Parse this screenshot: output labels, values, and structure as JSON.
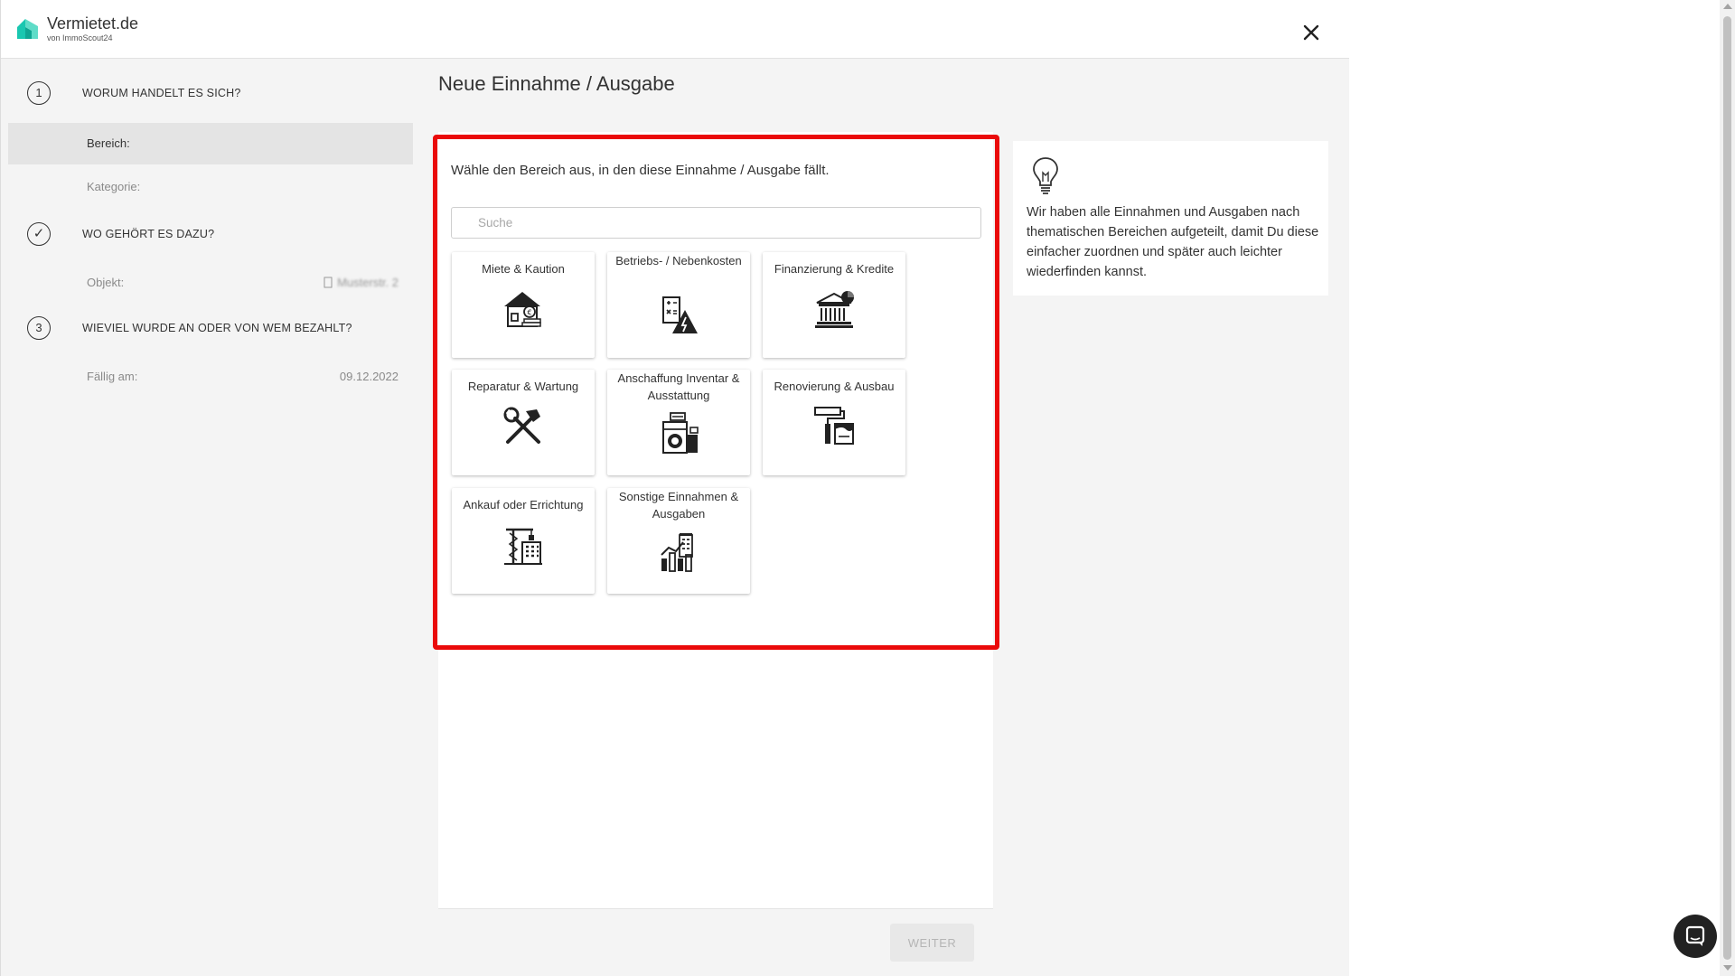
{
  "brand": {
    "name": "Vermietet.de",
    "sub": "von ImmoScout24",
    "color": "#19c7b0"
  },
  "icons": {
    "close": "close-icon",
    "logo": "house-logo-icon",
    "tip": "lightbulb-icon",
    "chat": "chat-icon",
    "object": "building-icon"
  },
  "sidebar": {
    "steps": [
      {
        "marker": "1",
        "title": "WORUM HANDELT ES SICH?"
      },
      {
        "marker": "✓",
        "title": "WO GEHÖRT ES DAZU?"
      },
      {
        "marker": "3",
        "title": "WIEVIEL WURDE AN ODER VON WEM BEZAHLT?"
      }
    ],
    "fields": {
      "bereich": {
        "label": "Bereich:",
        "value": ""
      },
      "kategorie": {
        "label": "Kategorie:",
        "value": ""
      },
      "objekt": {
        "label": "Objekt:",
        "value": "Musterstr. 2"
      },
      "faellig": {
        "label": "Fällig am:",
        "value": "09.12.2022"
      }
    }
  },
  "main": {
    "title": "Neue Einnahme / Ausgabe",
    "instruction": "Wähle den Bereich aus, in den diese Einnahme / Ausgabe fällt.",
    "search_placeholder": "Suche",
    "tiles": [
      {
        "label": "Miete & Kaution",
        "icon": "house-coins-icon"
      },
      {
        "label": "Betriebs- / Nebenkosten",
        "icon": "calculator-electricity-icon"
      },
      {
        "label": "Finanzierung & Kredite",
        "icon": "bank-icon"
      },
      {
        "label": "Reparatur & Wartung",
        "icon": "hammer-wrench-icon"
      },
      {
        "label": "Anschaffung Inventar & Ausstattung",
        "icon": "appliances-icon"
      },
      {
        "label": "Renovierung & Ausbau",
        "icon": "paint-roller-icon"
      },
      {
        "label": "Ankauf oder Errichtung",
        "icon": "crane-building-icon"
      },
      {
        "label": "Sonstige Einnahmen & Ausgaben",
        "icon": "chart-building-icon"
      }
    ],
    "next_button": "WEITER"
  },
  "tip": {
    "text": "Wir haben alle Einnahmen und Ausgaben nach thematischen Bereichen aufgeteilt, damit Du diese einfacher zuordnen und später auch leichter wiederfinden kannst."
  },
  "colors": {
    "highlight": "#ea0a0a",
    "accent": "#19c7b0",
    "background": "#f4f4f4",
    "disabled_button": "#e8e8e8"
  }
}
